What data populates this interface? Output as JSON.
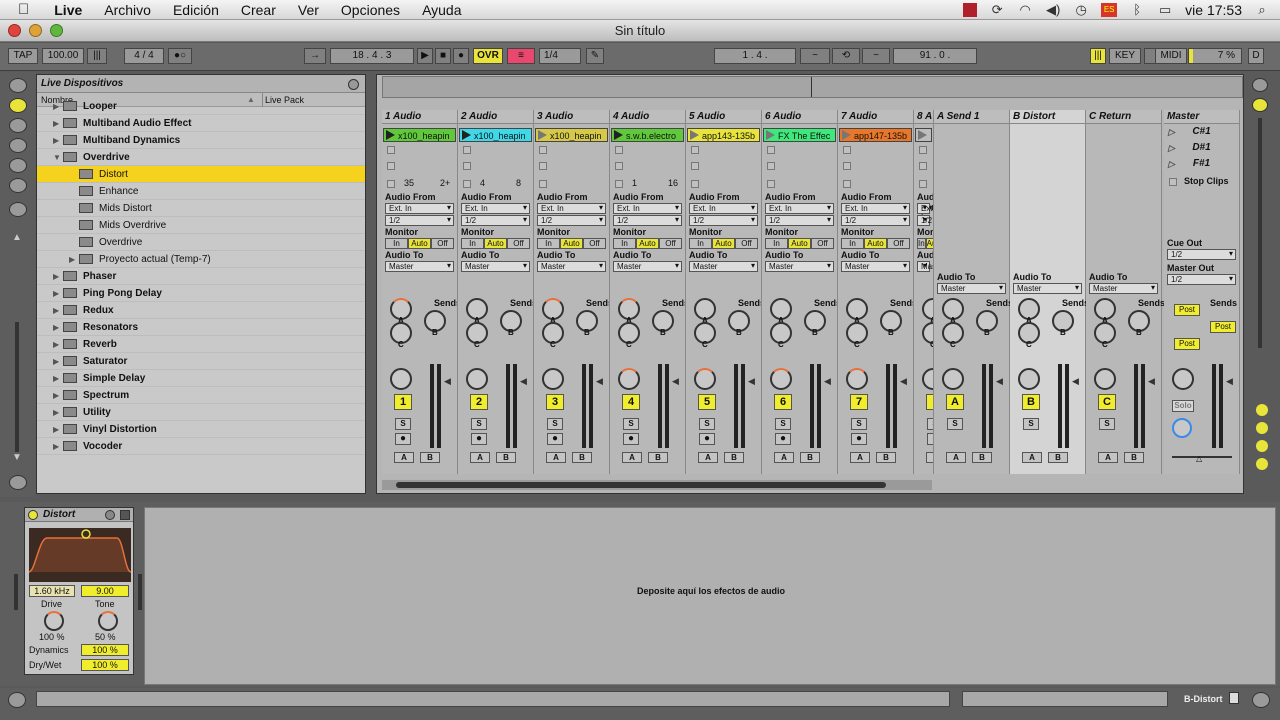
{
  "menubar": {
    "apple": "",
    "items": [
      "Live",
      "Archivo",
      "Edición",
      "Crear",
      "Ver",
      "Opciones",
      "Ayuda"
    ],
    "clock": "vie 17:53"
  },
  "window": {
    "title": "Sin título"
  },
  "transport": {
    "tap": "TAP",
    "tempo": "100.00",
    "signature": "4 / 4",
    "position": "18 .   4 .   3",
    "ovr": "OVR",
    "quantize": "1/4",
    "loop_start": "1 .   4 .",
    "loop_length": "91 .   0 .",
    "key": "KEY",
    "midi": "MIDI",
    "cpu": "7 %",
    "d": "D"
  },
  "browser": {
    "title": "Live Dispositivos",
    "col_name": "Nombre",
    "col_pack": "Live Pack",
    "items": [
      {
        "label": "Looper",
        "level": 0,
        "arrow": "▶"
      },
      {
        "label": "Multiband Audio Effect",
        "level": 0,
        "arrow": "▶"
      },
      {
        "label": "Multiband Dynamics",
        "level": 0,
        "arrow": "▶"
      },
      {
        "label": "Overdrive",
        "level": 0,
        "arrow": "▼"
      },
      {
        "label": "Distort",
        "level": 1,
        "arrow": "",
        "selected": true
      },
      {
        "label": "Enhance",
        "level": 1,
        "arrow": ""
      },
      {
        "label": "Mids Distort",
        "level": 1,
        "arrow": ""
      },
      {
        "label": "Mids Overdrive",
        "level": 1,
        "arrow": ""
      },
      {
        "label": "Overdrive",
        "level": 1,
        "arrow": ""
      },
      {
        "label": "Proyecto actual (Temp-7)",
        "level": 1,
        "arrow": "▶"
      },
      {
        "label": "Phaser",
        "level": 0,
        "arrow": "▶"
      },
      {
        "label": "Ping Pong Delay",
        "level": 0,
        "arrow": "▶"
      },
      {
        "label": "Redux",
        "level": 0,
        "arrow": "▶"
      },
      {
        "label": "Resonators",
        "level": 0,
        "arrow": "▶"
      },
      {
        "label": "Reverb",
        "level": 0,
        "arrow": "▶"
      },
      {
        "label": "Saturator",
        "level": 0,
        "arrow": "▶"
      },
      {
        "label": "Simple Delay",
        "level": 0,
        "arrow": "▶"
      },
      {
        "label": "Spectrum",
        "level": 0,
        "arrow": "▶"
      },
      {
        "label": "Utility",
        "level": 0,
        "arrow": "▶"
      },
      {
        "label": "Vinyl Distortion",
        "level": 0,
        "arrow": "▶"
      },
      {
        "label": "Vocoder",
        "level": 0,
        "arrow": "▶"
      }
    ]
  },
  "mixer_labels": {
    "audio_from": "Audio From",
    "ext_in": "Ext. In",
    "input_ch": "1/2",
    "monitor": "Monitor",
    "mon_in": "In",
    "mon_auto": "Auto",
    "mon_off": "Off",
    "audio_to": "Audio To",
    "master": "Master",
    "sends": "Sends",
    "knob_a": "A",
    "knob_b": "B",
    "knob_c": "C",
    "solo": "S",
    "btn_a": "A",
    "btn_b": "B",
    "stop_clips": "Stop Clips",
    "cue_out": "Cue Out",
    "cue_ch": "1/2",
    "master_out": "Master Out",
    "master_ch": "1/2",
    "post": "Post",
    "solo_label": "Solo"
  },
  "tracks": [
    {
      "name": "1 Audio",
      "clip": "x100_heapin",
      "clip_color": "#5fc83b",
      "num": "1",
      "playing": true,
      "ctr_a": "35",
      "ctr_b": "2+"
    },
    {
      "name": "2 Audio",
      "clip": "x100_heapin",
      "clip_color": "#3ed8e8",
      "num": "2",
      "playing": true,
      "ctr_a": "4",
      "ctr_b": "8"
    },
    {
      "name": "3 Audio",
      "clip": "x100_heapin",
      "clip_color": "#d6c94a",
      "num": "3",
      "playing": false,
      "ctr_a": "",
      "ctr_b": ""
    },
    {
      "name": "4 Audio",
      "clip": "s.w.b.electro",
      "clip_color": "#5fc83b",
      "num": "4",
      "playing": true,
      "ctr_a": "1",
      "ctr_b": "16"
    },
    {
      "name": "5 Audio",
      "clip": "app143-135b",
      "clip_color": "#e8e43a",
      "num": "5",
      "playing": false,
      "ctr_a": "",
      "ctr_b": ""
    },
    {
      "name": "6 Audio",
      "clip": "FX The Effec",
      "clip_color": "#3ee87a",
      "num": "6",
      "playing": false,
      "ctr_a": "",
      "ctr_b": ""
    },
    {
      "name": "7 Audio",
      "clip": "app147-135b",
      "clip_color": "#e8772a",
      "num": "7",
      "playing": false,
      "ctr_a": "",
      "ctr_b": ""
    },
    {
      "name": "8 A",
      "clip": "",
      "clip_color": "#bdbdbd",
      "num": "",
      "playing": false,
      "ctr_a": "",
      "ctr_b": ""
    }
  ],
  "returns": [
    {
      "name": "A Send 1",
      "letter": "A"
    },
    {
      "name": "B Distort",
      "letter": "B"
    },
    {
      "name": "C Return",
      "letter": "C"
    }
  ],
  "master_track": {
    "name": "Master",
    "scenes": [
      "C#1",
      "D#1",
      "F#1"
    ]
  },
  "device": {
    "name": "Distort",
    "freq": "1.60 kHz",
    "q": "9.00",
    "drive_label": "Drive",
    "drive_val": "100 %",
    "tone_label": "Tone",
    "tone_val": "50 %",
    "dynamics_label": "Dynamics",
    "dynamics_val": "100 %",
    "drywet_label": "Dry/Wet",
    "drywet_val": "100 %"
  },
  "dropzone": {
    "text": "Deposite aquí los efectos de audio"
  },
  "statusbar": {
    "track": "B-Distort"
  },
  "colors": {
    "accent_yellow": "#f0ed2d",
    "selection": "#f5d21e",
    "panel": "#c9c9c9"
  }
}
